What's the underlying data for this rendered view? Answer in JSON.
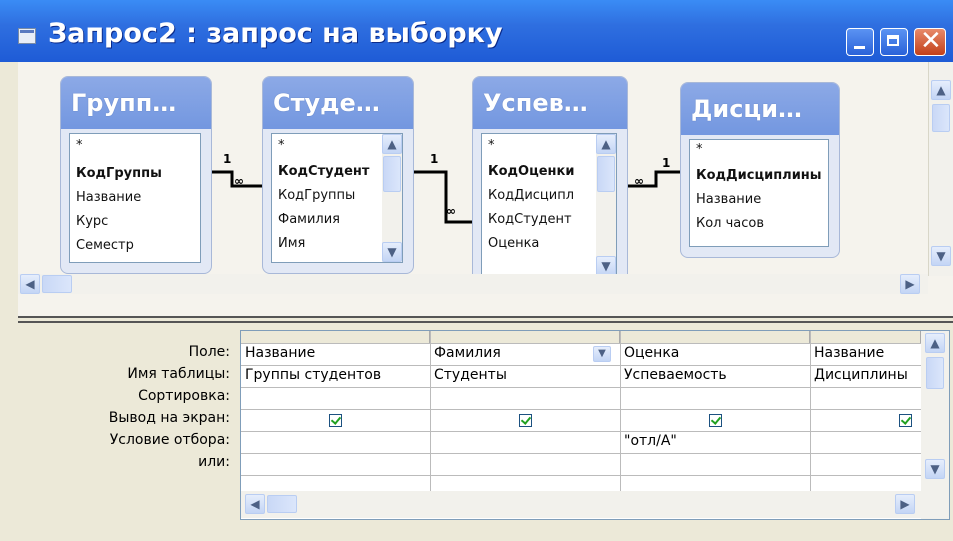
{
  "window": {
    "title": "Запрос2 : запрос на выборку"
  },
  "tables": [
    {
      "title": "Групп…",
      "fields": [
        {
          "name": "*",
          "key": false
        },
        {
          "name": "КодГруппы",
          "key": true
        },
        {
          "name": "Название",
          "key": false
        },
        {
          "name": "Курс",
          "key": false
        },
        {
          "name": "Семестр",
          "key": false
        }
      ]
    },
    {
      "title": "Студе…",
      "fields": [
        {
          "name": "*",
          "key": false
        },
        {
          "name": "КодСтудент",
          "key": true
        },
        {
          "name": "КодГруппы",
          "key": false
        },
        {
          "name": "Фамилия",
          "key": false
        },
        {
          "name": "Имя",
          "key": false
        }
      ]
    },
    {
      "title": "Успев…",
      "fields": [
        {
          "name": "*",
          "key": false
        },
        {
          "name": "КодОценки",
          "key": true
        },
        {
          "name": "КодДисципл",
          "key": false
        },
        {
          "name": "КодСтудент",
          "key": false
        },
        {
          "name": "Оценка",
          "key": false
        }
      ]
    },
    {
      "title": "Дисци…",
      "fields": [
        {
          "name": "*",
          "key": false
        },
        {
          "name": "КодДисциплины",
          "key": true
        },
        {
          "name": "Название",
          "key": false
        },
        {
          "name": "Кол часов",
          "key": false
        }
      ]
    }
  ],
  "relations": {
    "one": "1",
    "many": "∞"
  },
  "grid": {
    "row_labels": [
      "Поле:",
      "Имя таблицы:",
      "Сортировка:",
      "Вывод на экран:",
      "Условие отбора:",
      "или:"
    ],
    "columns": [
      {
        "field": "Название",
        "table": "Группы студентов",
        "sort": "",
        "show": true,
        "criteria": "",
        "or": ""
      },
      {
        "field": "Фамилия",
        "table": "Студенты",
        "sort": "",
        "show": true,
        "criteria": "",
        "or": ""
      },
      {
        "field": "Оценка",
        "table": "Успеваемость",
        "sort": "",
        "show": true,
        "criteria": "\"отл/А\"",
        "or": ""
      },
      {
        "field": "Название",
        "table": "Дисциплины",
        "sort": "",
        "show": true,
        "criteria": "",
        "or": ""
      }
    ]
  },
  "icons": {
    "window": "query-window-icon",
    "minimize": "minimize-icon",
    "maximize": "maximize-icon",
    "close": "close-icon",
    "scroll_up": "chevron-up-icon",
    "scroll_down": "chevron-down-icon",
    "scroll_left": "chevron-left-icon",
    "scroll_right": "chevron-right-icon",
    "dropdown": "chevron-down-icon",
    "checkbox_checked": "checkmark-icon"
  },
  "colors": {
    "titlebar": "#2f6fe0",
    "table_header": "#7f9fe3",
    "check": "#21a121",
    "close_button": "#d9532a"
  }
}
